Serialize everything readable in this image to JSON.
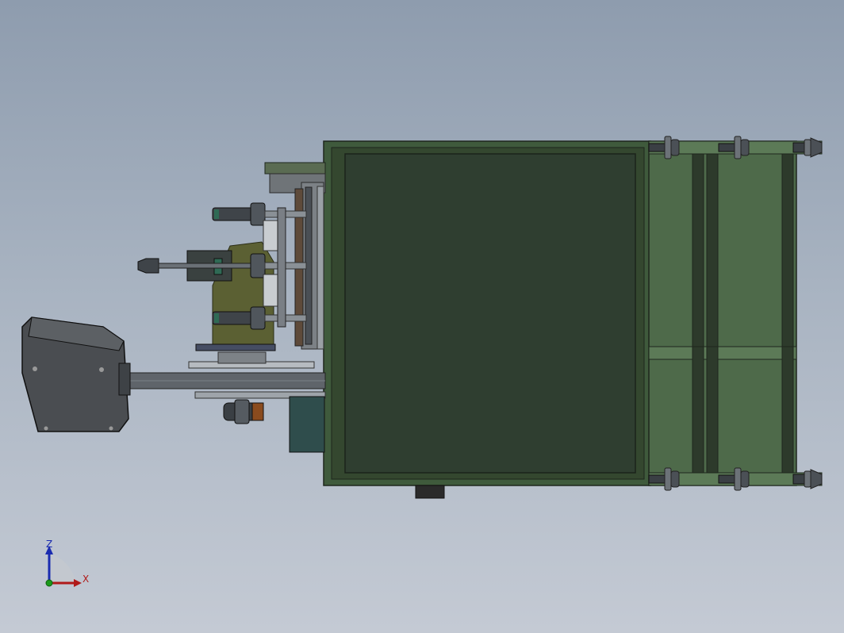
{
  "viewport": {
    "name": "3D model view",
    "background_top": "#8e9cae",
    "background_bottom": "#c4cad4"
  },
  "model": {
    "cabinet_color": "#2f3e30",
    "frame_color": "#4e6a4a",
    "rail_color": "#3a4d3a",
    "motor_color": "#5a5a5a",
    "steel_color": "#5f646a"
  },
  "triad": {
    "z_label": "Z",
    "x_label": "X",
    "z_color": "#1a2bb0",
    "x_color": "#b01a1a",
    "y_color": "#1a9a1a"
  }
}
